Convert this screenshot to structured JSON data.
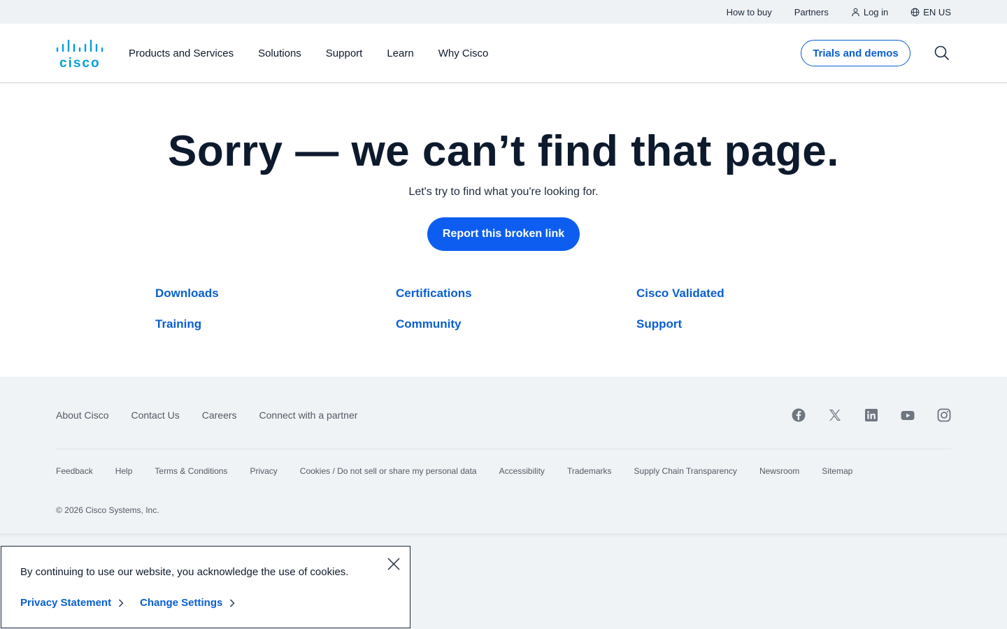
{
  "utility_bar": {
    "how_to_buy": "How to buy",
    "partners": "Partners",
    "log_in": "Log in",
    "language": "EN US"
  },
  "nav": {
    "items": [
      "Products and Services",
      "Solutions",
      "Support",
      "Learn",
      "Why Cisco"
    ],
    "trials_label": "Trials and demos"
  },
  "logo": {
    "text": "cisco",
    "color": "#049fd9"
  },
  "content": {
    "title": "Sorry — we can’t find that page.",
    "subtitle": "Let's try to find what you're looking for.",
    "report_label": "Report this broken link",
    "links": [
      "Downloads",
      "Certifications",
      "Cisco Validated",
      "Training",
      "Community",
      "Support"
    ]
  },
  "footer": {
    "primary_links": [
      "About Cisco",
      "Contact Us",
      "Careers",
      "Connect with a partner"
    ],
    "social": [
      "facebook-icon",
      "x-icon",
      "linkedin-icon",
      "youtube-icon",
      "instagram-icon"
    ],
    "secondary_links": [
      "Feedback",
      "Help",
      "Terms & Conditions",
      "Privacy",
      "Cookies / Do not sell or share my personal data",
      "Accessibility",
      "Trademarks",
      "Supply Chain Transparency",
      "Newsroom",
      "Sitemap"
    ],
    "copyright": "© 2026 Cisco Systems, Inc."
  },
  "cookie_banner": {
    "message": "By continuing to use our website, you acknowledge the use of cookies.",
    "privacy_label": "Privacy Statement",
    "settings_label": "Change Settings"
  },
  "colors": {
    "accent": "#0a5fd0",
    "button": "#0d5ef0",
    "logo": "#049fd9"
  }
}
